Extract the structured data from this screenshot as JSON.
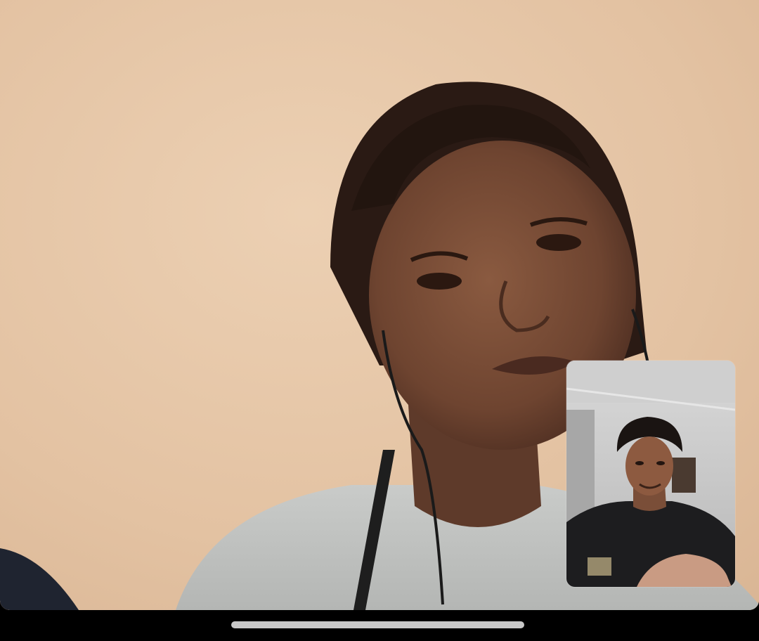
{
  "call": {
    "remote_participant_feed": "remote-video",
    "self_view_feed": "self-video"
  },
  "colors": {
    "wall": "#e6c7a8",
    "background": "#000000",
    "home_indicator": "#c8c8c8"
  },
  "icons": {
    "home_indicator": "home-indicator"
  }
}
